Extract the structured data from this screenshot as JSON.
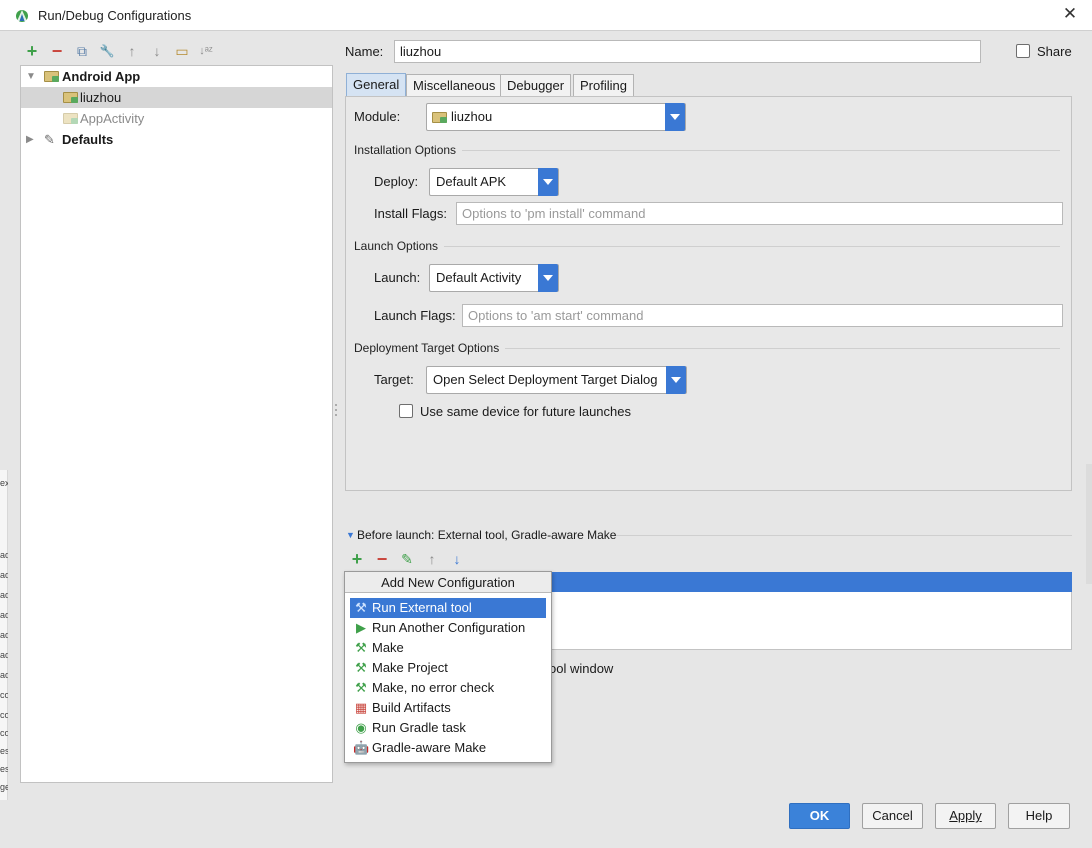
{
  "window": {
    "title": "Run/Debug Configurations",
    "close_glyph": "✕"
  },
  "toolbar": {
    "add_glyph": "+",
    "remove_glyph": "−",
    "copy_glyph": "⧉",
    "edit_defaults_glyph": "🔧",
    "up_glyph": "↑",
    "down_glyph": "↓",
    "folder_glyph": "▭",
    "sort_glyph": "↓ᵃᶻ"
  },
  "tree": {
    "group_label": "Android App",
    "items": [
      {
        "label": "liuzhou"
      },
      {
        "label": "AppActivity"
      }
    ],
    "defaults_label": "Defaults"
  },
  "config": {
    "name_label": "Name:",
    "name_value": "liuzhou",
    "share_label": "Share"
  },
  "tabs": [
    "General",
    "Miscellaneous",
    "Debugger",
    "Profiling"
  ],
  "general": {
    "module_label": "Module:",
    "module_value": "liuzhou",
    "installation_title": "Installation Options",
    "deploy_label": "Deploy:",
    "deploy_value": "Default APK",
    "install_flags_label": "Install Flags:",
    "install_flags_placeholder": "Options to 'pm install' command",
    "launch_title": "Launch Options",
    "launch_label": "Launch:",
    "launch_value": "Default Activity",
    "launch_flags_label": "Launch Flags:",
    "launch_flags_placeholder": "Options to 'am start' command",
    "deployment_title": "Deployment Target Options",
    "target_label": "Target:",
    "target_value": "Open Select Deployment Target Dialog",
    "same_device_label": "Use same device for future launches"
  },
  "before_launch": {
    "title": "Before launch: External tool, Gradle-aware Make",
    "tool_window_tail": "ool window"
  },
  "popup": {
    "header": "Add New Configuration",
    "items": [
      {
        "label": "Run External tool",
        "icon": "external-tool-icon"
      },
      {
        "label": "Run Another Configuration",
        "icon": "run-icon"
      },
      {
        "label": "Make",
        "icon": "hammer-icon"
      },
      {
        "label": "Make Project",
        "icon": "hammer-icon"
      },
      {
        "label": "Make, no error check",
        "icon": "hammer-icon"
      },
      {
        "label": "Build Artifacts",
        "icon": "artifacts-icon"
      },
      {
        "label": "Run Gradle task",
        "icon": "gradle-icon"
      },
      {
        "label": "Gradle-aware Make",
        "icon": "android-icon"
      }
    ]
  },
  "buttons": {
    "ok": "OK",
    "cancel": "Cancel",
    "apply": "Apply",
    "help": "Help"
  },
  "background_left_fragments": [
    "ex",
    "ad",
    "ad",
    "ad",
    "ad",
    "ad",
    "ad",
    "ad",
    "co",
    "co",
    "co",
    "es",
    "es",
    "ge"
  ],
  "colors": {
    "accent": "#3a78d4",
    "add_green": "#3fa04a",
    "remove_red": "#c9463d"
  }
}
